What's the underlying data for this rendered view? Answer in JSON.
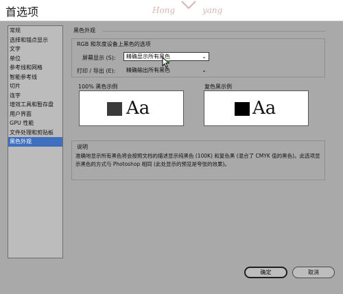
{
  "window": {
    "title": "首选项",
    "watermark_text": [
      "Hong",
      "yang"
    ]
  },
  "sidebar": {
    "items": [
      {
        "label": "常规",
        "selected": false
      },
      {
        "label": "选择和锚点显示",
        "selected": false
      },
      {
        "label": "文字",
        "selected": false
      },
      {
        "label": "单位",
        "selected": false
      },
      {
        "label": "参考线和网格",
        "selected": false
      },
      {
        "label": "智能参考线",
        "selected": false
      },
      {
        "label": "切片",
        "selected": false
      },
      {
        "label": "连字",
        "selected": false
      },
      {
        "label": "增效工具和暂存盘",
        "selected": false
      },
      {
        "label": "用户界面",
        "selected": false
      },
      {
        "label": "GPU 性能",
        "selected": false
      },
      {
        "label": "文件处理和剪贴板",
        "selected": false
      },
      {
        "label": "黑色外观",
        "selected": true
      }
    ]
  },
  "main": {
    "section_title": "黑色外观",
    "rgb_group": {
      "title": "RGB 和灰度设备上黑色的选项",
      "screen_label": "屏幕显示 (S):",
      "screen_value": "精确显示所有黑色",
      "print_label": "打印 / 导出 (E):",
      "print_value": "精确输出所有黑色"
    },
    "samples": {
      "left_label": "100% 黑色示例",
      "right_label": "复色黑示例",
      "text": "Aa",
      "left_color": "#3a3a3a",
      "right_color": "#000000"
    },
    "description": {
      "title": "说明",
      "text": "准确地显示所有黑色将会按照文档的描述显示纯黑色 (100K) 和复色黑 (混合了 CMYK 值的黑色)。此选项显示黑色的方式与 Photoshop 相同 (此处显示的预览是夸张的效果)。"
    }
  },
  "buttons": {
    "ok": "确定",
    "cancel": "取消"
  },
  "colors": {
    "selection": "#3f6fbf",
    "dialog_bg": "#a9a9a9"
  }
}
